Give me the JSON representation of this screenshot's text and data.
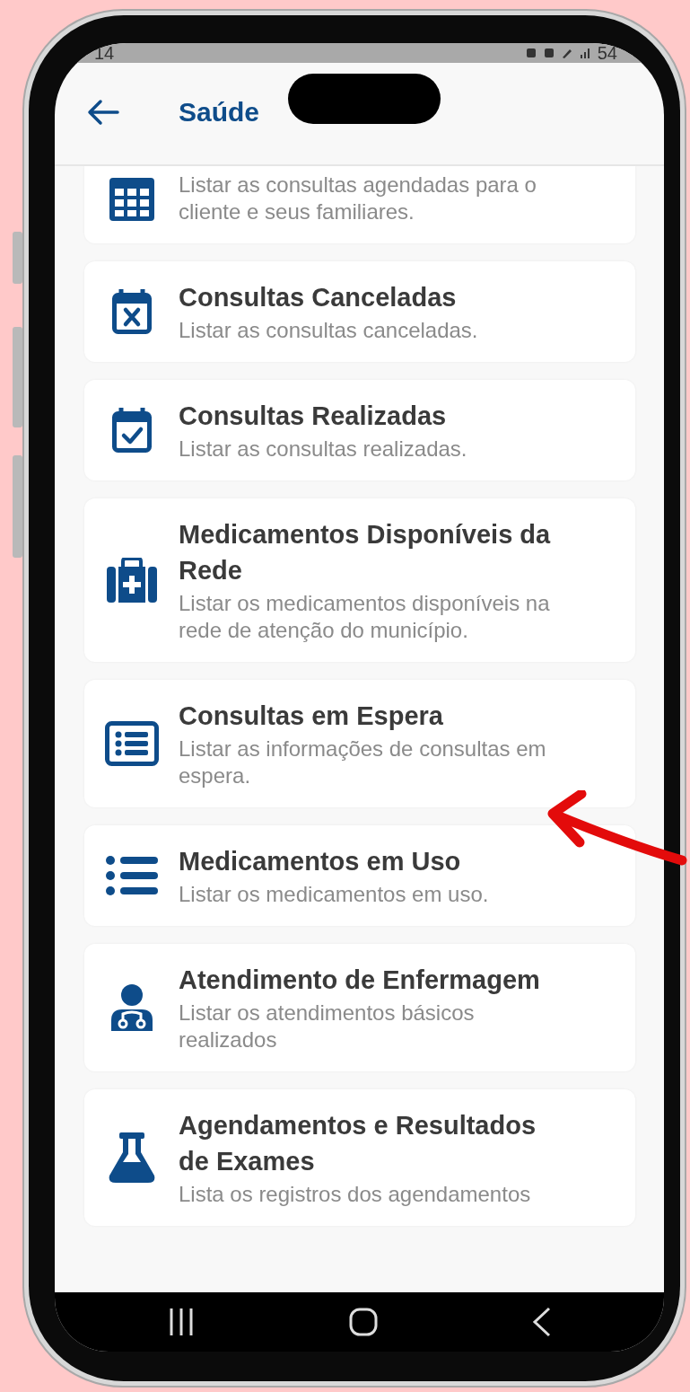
{
  "status_bar": {
    "time": "14",
    "battery": "54"
  },
  "header": {
    "title": "Saúde"
  },
  "items": [
    {
      "description": "Listar as consultas agendadas para o cliente e seus familiares."
    },
    {
      "title": "Consultas Canceladas",
      "description": "Listar as consultas canceladas."
    },
    {
      "title": "Consultas Realizadas",
      "description": "Listar as consultas realizadas."
    },
    {
      "title": "Medicamentos Disponíveis da Rede",
      "description": "Listar os medicamentos disponíveis na rede de atenção do município."
    },
    {
      "title": "Consultas em Espera",
      "description": "Listar as informações de consultas em espera."
    },
    {
      "title": "Medicamentos em Uso",
      "description": "Listar os medicamentos em uso."
    },
    {
      "title": "Atendimento de Enfermagem",
      "description": "Listar os atendimentos básicos realizados"
    },
    {
      "title": "Agendamentos e Resultados de Exames",
      "description": "Lista os registros dos agendamentos"
    }
  ]
}
